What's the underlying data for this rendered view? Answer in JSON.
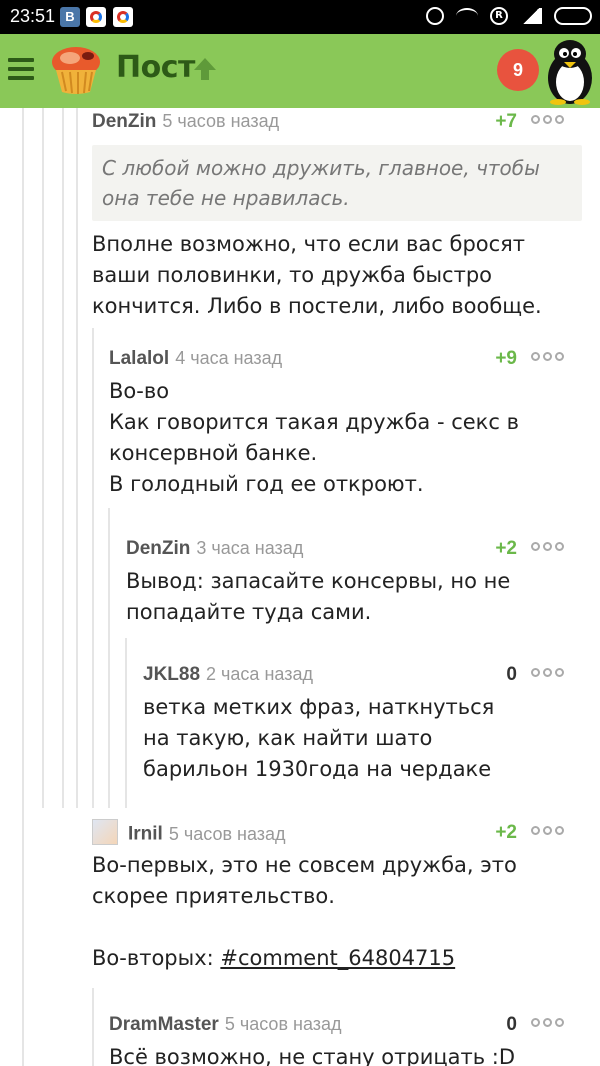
{
  "status_bar": {
    "time": "23:51",
    "apps": [
      "vk-icon",
      "chrome-icon",
      "chrome-icon"
    ],
    "vk_letter": "В",
    "reg_letter": "R"
  },
  "app_bar": {
    "title": "Пост",
    "notifications": "9",
    "colors": {
      "bar": "#8ac858",
      "badge": "#e8533e",
      "title": "#2d5a17"
    }
  },
  "comments": [
    {
      "user": "DenZin",
      "time": "5 часов назад",
      "rating": "+7",
      "quote": "С любой можно дружить, главное, чтобы она тебе не нравилась.",
      "text": "Вполне возможно, что если вас бросят ваши половинки, то дружба быстро кончится. Либо в постели, либо вообще."
    },
    {
      "user": "Lalalol",
      "time": "4 часа назад",
      "rating": "+9",
      "text": "Во-во\nКак говорится такая дружба - секс в консервной банке.\nВ голодный год ее откроют."
    },
    {
      "user": "DenZin",
      "time": "3 часа назад",
      "rating": "+2",
      "text": "Вывод: запасайте консервы, но не попадайте туда сами."
    },
    {
      "user": "JKL88",
      "time": "2 часа назад",
      "rating": "0",
      "text": "ветка метких фраз, наткнуться на такую, как найти шато барильон 1930года на чердаке"
    },
    {
      "user": "Irnil",
      "time": "5 часов назад",
      "rating": "+2",
      "text_1": "Во-первых, это не совсем дружба, это скорее приятельство.",
      "text_2_prefix": "Во-вторых: ",
      "link": "#comment_64804715"
    },
    {
      "user": "DramMaster",
      "time": "5 часов назад",
      "rating": "0",
      "text": "Всё возможно, не стану отрицать :D"
    }
  ]
}
